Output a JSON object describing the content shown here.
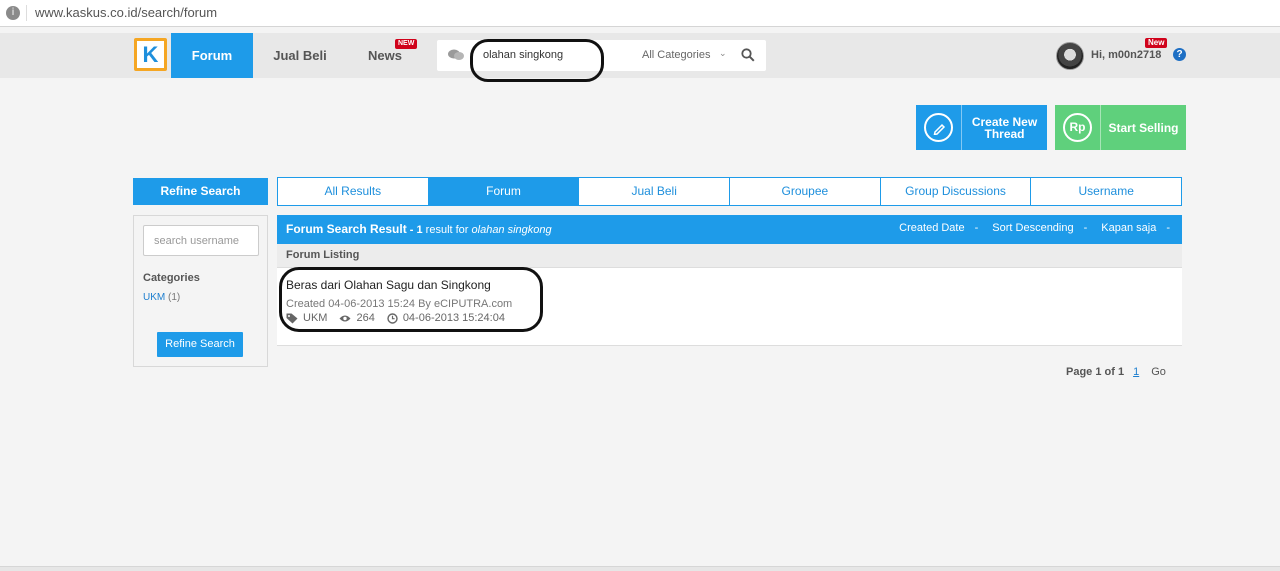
{
  "browser": {
    "url": "www.kaskus.co.id/search/forum"
  },
  "nav": {
    "logo": "K",
    "tabs": [
      {
        "label": "Forum",
        "active": true
      },
      {
        "label": "Jual Beli",
        "active": false
      },
      {
        "label": "News",
        "active": false,
        "badge": "NEW"
      }
    ],
    "search": {
      "value": "olahan singkong",
      "category": "All Categories"
    },
    "user": {
      "greeting": "Hi, m00n2718",
      "badge": "New"
    },
    "help": "?"
  },
  "actions": {
    "create_thread": "Create New Thread",
    "start_selling": "Start Selling",
    "rp_icon": "Rp"
  },
  "sidebar": {
    "refine_title": "Refine Search",
    "username_placeholder": "search username",
    "categories_title": "Categories",
    "category": {
      "name": "UKM",
      "count": "(1)"
    },
    "refine_button": "Refine Search"
  },
  "result_tabs": [
    "All Results",
    "Forum",
    "Jual Beli",
    "Groupee",
    "Group Discussions",
    "Username"
  ],
  "results": {
    "title": "Forum Search Result",
    "count_text": " - 1",
    "result_for": " result for ",
    "query": "olahan singkong",
    "sorters": [
      "Created Date",
      "Sort Descending",
      "Kapan saja"
    ],
    "listing_label": "Forum Listing",
    "thread": {
      "title": "Beras dari Olahan Sagu dan Singkong",
      "meta": "Created 04-06-2013 15:24 By eCIPUTRA.com",
      "category": "UKM",
      "views": "264",
      "last_post": "04-06-2013 15:24:04"
    }
  },
  "pagination": {
    "info": "Page 1 of 1",
    "current": "1",
    "go": "Go"
  },
  "colors": {
    "primary": "#1e9be9",
    "sell": "#5fd07c",
    "badge": "#d0021b",
    "logo_border": "#f5a623"
  }
}
